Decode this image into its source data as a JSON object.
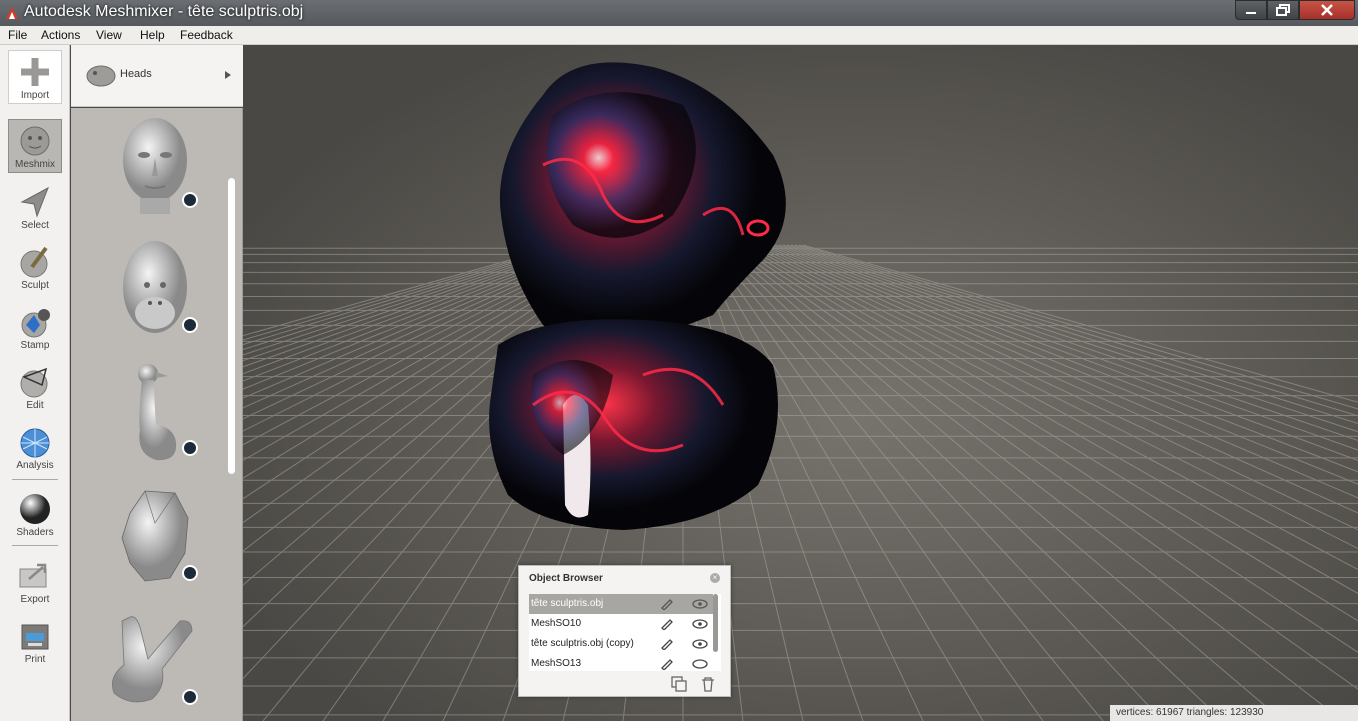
{
  "window": {
    "title": "Autodesk Meshmixer - tête sculptris.obj"
  },
  "menu": [
    "File",
    "Actions",
    "View",
    "Help",
    "Feedback"
  ],
  "toolbar": {
    "import": "Import",
    "meshmix": "Meshmix",
    "select": "Select",
    "sculpt": "Sculpt",
    "stamp": "Stamp",
    "edit": "Edit",
    "analysis": "Analysis",
    "shaders": "Shaders",
    "export": "Export",
    "print": "Print"
  },
  "library": {
    "category": "Heads",
    "items": [
      "human-head",
      "gorilla-head",
      "bird-body",
      "low-poly-head",
      "hand-peace"
    ]
  },
  "object_browser": {
    "title": "Object Browser",
    "rows": [
      {
        "name": "tête sculptris.obj",
        "selected": true
      },
      {
        "name": "MeshSO10",
        "selected": false
      },
      {
        "name": "tête sculptris.obj (copy)",
        "selected": false
      },
      {
        "name": "MeshSO13",
        "selected": false
      }
    ]
  },
  "status": {
    "text": "vertices: 61967 triangles: 123930"
  },
  "colors": {
    "accent_red": "#e0213a",
    "mesh_blue": "#3a4a8a",
    "panel": "#bdbab5"
  }
}
